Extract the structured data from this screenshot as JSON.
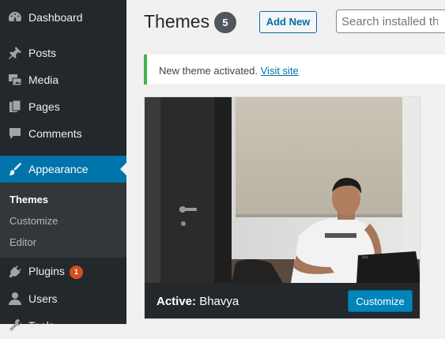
{
  "sidebar": {
    "items": [
      {
        "key": "dashboard",
        "label": "Dashboard",
        "icon": "dashboard-icon"
      },
      {
        "key": "posts",
        "label": "Posts",
        "icon": "pushpin-icon"
      },
      {
        "key": "media",
        "label": "Media",
        "icon": "media-icon"
      },
      {
        "key": "pages",
        "label": "Pages",
        "icon": "pages-icon"
      },
      {
        "key": "comments",
        "label": "Comments",
        "icon": "comment-icon"
      },
      {
        "key": "appearance",
        "label": "Appearance",
        "icon": "paintbrush-icon",
        "active": true
      },
      {
        "key": "plugins",
        "label": "Plugins",
        "icon": "plugin-icon",
        "badge": "1"
      },
      {
        "key": "users",
        "label": "Users",
        "icon": "users-icon"
      },
      {
        "key": "tools",
        "label": "Tools",
        "icon": "tools-icon"
      }
    ],
    "submenu": [
      {
        "label": "Themes",
        "current": true
      },
      {
        "label": "Customize"
      },
      {
        "label": "Editor"
      }
    ],
    "colors": {
      "bg": "#23282d",
      "active": "#0073aa",
      "submenu_bg": "#32373c",
      "badge": "#d54e21"
    }
  },
  "header": {
    "title": "Themes",
    "count": "5",
    "add_new_label": "Add New",
    "search_placeholder": "Search installed themes..."
  },
  "notice": {
    "text": "New theme activated. ",
    "link_text": "Visit site",
    "accent_color": "#46b450"
  },
  "theme_card": {
    "active_prefix": "Active:",
    "name": "Bhavya",
    "customize_label": "Customize",
    "button_color": "#0085ba"
  }
}
